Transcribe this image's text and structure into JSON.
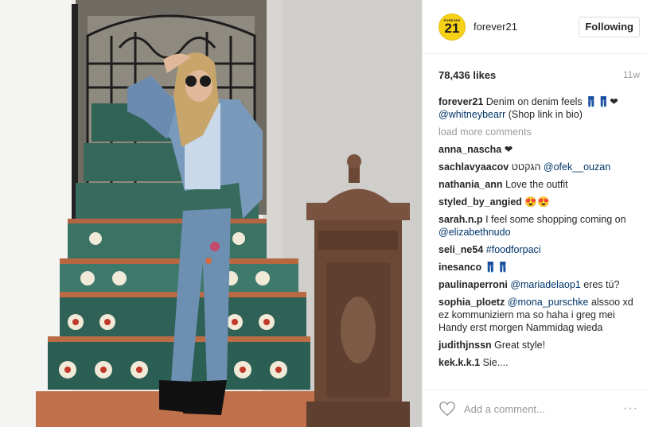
{
  "post": {
    "photo_subject": "woman in denim jacket and jeans on tiled staircase",
    "account": {
      "avatar_top": "FOREVER",
      "avatar_num": "21",
      "username": "forever21",
      "follow_label": "Following"
    },
    "likes": "78,436 likes",
    "age": "11w",
    "caption": {
      "user": "forever21",
      "text": "Denim on denim feels 👖👖❤",
      "mention": "@whitneybearr",
      "suffix": "(Shop link in bio)"
    },
    "load_more": "load more comments",
    "comments": [
      {
        "user": "anna_nascha",
        "text": "❤"
      },
      {
        "user": "sachlavyaacov",
        "text": "הגקטט ",
        "mention": "@ofek__ouzan"
      },
      {
        "user": "nathania_ann",
        "text": "Love the outfit"
      },
      {
        "user": "styled_by_angied",
        "text": "😍😍"
      },
      {
        "user": "sarah.n.p",
        "text": "I feel some shopping coming on ",
        "mention": "@elizabethnudo"
      },
      {
        "user": "seli_ne54",
        "text": "",
        "mention": "#foodforpaci"
      },
      {
        "user": "inesanco",
        "text": "👖👖"
      },
      {
        "user": "paulinaperroni",
        "text": "eres tú?",
        "mention": "@mariadelaop1"
      },
      {
        "user": "sophia_ploetz",
        "text": "alssoo xd ez kommuniziern ma so haha i greg mei Handy erst morgen Nammidag wieda",
        "mention": "@mona_purschke"
      },
      {
        "user": "judithjnssn",
        "text": "Great style!"
      },
      {
        "user": "kek.k.k.1",
        "text": "Sie...."
      }
    ],
    "add_comment_placeholder": "Add a comment...",
    "more_label": "···",
    "icons": {
      "heart": "heart-outline-icon",
      "more": "more-options-icon"
    }
  }
}
